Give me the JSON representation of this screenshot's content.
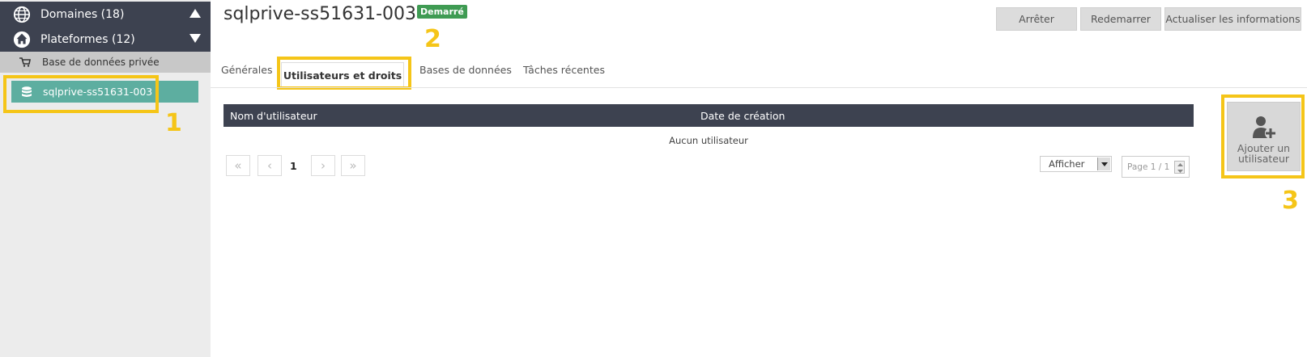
{
  "sidebar": {
    "domains_label": "Domaines (18)",
    "platforms_label": "Plateformes (12)",
    "subcategory_label": "Base de données privée",
    "selected_item_label": "sqlprive-ss51631-003"
  },
  "header": {
    "title": "sqlprive-ss51631-003",
    "status_badge": "Demarré",
    "buttons": {
      "stop": "Arrêter",
      "restart": "Redemarrer",
      "refresh": "Actualiser les informations"
    }
  },
  "tabs": {
    "general": "Générales",
    "users": "Utilisateurs et droits",
    "databases": "Bases de données",
    "recent_tasks": "Tâches récentes"
  },
  "table": {
    "columns": [
      "Nom d'utilisateur",
      "Date de création"
    ],
    "empty_message": "Aucun utilisateur"
  },
  "pager": {
    "current_page": "1",
    "show_label": "Afficher",
    "page_indicator": "Page 1 / 1"
  },
  "add_user": {
    "label": "Ajouter un utilisateur"
  },
  "callouts": {
    "one": "1",
    "two": "2",
    "three": "3"
  },
  "colors": {
    "sidebar_header_bg": "#3d4250",
    "selected_item_bg": "#5daea0",
    "status_badge_bg": "#3f9b53",
    "callout_yellow": "#f5c518"
  }
}
